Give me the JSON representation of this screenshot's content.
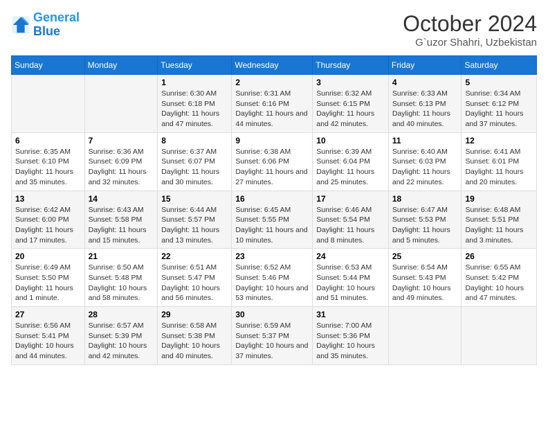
{
  "header": {
    "logo_line1": "General",
    "logo_line2": "Blue",
    "month": "October 2024",
    "location": "G`uzor Shahri, Uzbekistan"
  },
  "weekdays": [
    "Sunday",
    "Monday",
    "Tuesday",
    "Wednesday",
    "Thursday",
    "Friday",
    "Saturday"
  ],
  "weeks": [
    [
      {
        "day": "",
        "content": ""
      },
      {
        "day": "",
        "content": ""
      },
      {
        "day": "1",
        "content": "Sunrise: 6:30 AM\nSunset: 6:18 PM\nDaylight: 11 hours and 47 minutes."
      },
      {
        "day": "2",
        "content": "Sunrise: 6:31 AM\nSunset: 6:16 PM\nDaylight: 11 hours and 44 minutes."
      },
      {
        "day": "3",
        "content": "Sunrise: 6:32 AM\nSunset: 6:15 PM\nDaylight: 11 hours and 42 minutes."
      },
      {
        "day": "4",
        "content": "Sunrise: 6:33 AM\nSunset: 6:13 PM\nDaylight: 11 hours and 40 minutes."
      },
      {
        "day": "5",
        "content": "Sunrise: 6:34 AM\nSunset: 6:12 PM\nDaylight: 11 hours and 37 minutes."
      }
    ],
    [
      {
        "day": "6",
        "content": "Sunrise: 6:35 AM\nSunset: 6:10 PM\nDaylight: 11 hours and 35 minutes."
      },
      {
        "day": "7",
        "content": "Sunrise: 6:36 AM\nSunset: 6:09 PM\nDaylight: 11 hours and 32 minutes."
      },
      {
        "day": "8",
        "content": "Sunrise: 6:37 AM\nSunset: 6:07 PM\nDaylight: 11 hours and 30 minutes."
      },
      {
        "day": "9",
        "content": "Sunrise: 6:38 AM\nSunset: 6:06 PM\nDaylight: 11 hours and 27 minutes."
      },
      {
        "day": "10",
        "content": "Sunrise: 6:39 AM\nSunset: 6:04 PM\nDaylight: 11 hours and 25 minutes."
      },
      {
        "day": "11",
        "content": "Sunrise: 6:40 AM\nSunset: 6:03 PM\nDaylight: 11 hours and 22 minutes."
      },
      {
        "day": "12",
        "content": "Sunrise: 6:41 AM\nSunset: 6:01 PM\nDaylight: 11 hours and 20 minutes."
      }
    ],
    [
      {
        "day": "13",
        "content": "Sunrise: 6:42 AM\nSunset: 6:00 PM\nDaylight: 11 hours and 17 minutes."
      },
      {
        "day": "14",
        "content": "Sunrise: 6:43 AM\nSunset: 5:58 PM\nDaylight: 11 hours and 15 minutes."
      },
      {
        "day": "15",
        "content": "Sunrise: 6:44 AM\nSunset: 5:57 PM\nDaylight: 11 hours and 13 minutes."
      },
      {
        "day": "16",
        "content": "Sunrise: 6:45 AM\nSunset: 5:55 PM\nDaylight: 11 hours and 10 minutes."
      },
      {
        "day": "17",
        "content": "Sunrise: 6:46 AM\nSunset: 5:54 PM\nDaylight: 11 hours and 8 minutes."
      },
      {
        "day": "18",
        "content": "Sunrise: 6:47 AM\nSunset: 5:53 PM\nDaylight: 11 hours and 5 minutes."
      },
      {
        "day": "19",
        "content": "Sunrise: 6:48 AM\nSunset: 5:51 PM\nDaylight: 11 hours and 3 minutes."
      }
    ],
    [
      {
        "day": "20",
        "content": "Sunrise: 6:49 AM\nSunset: 5:50 PM\nDaylight: 11 hours and 1 minute."
      },
      {
        "day": "21",
        "content": "Sunrise: 6:50 AM\nSunset: 5:48 PM\nDaylight: 10 hours and 58 minutes."
      },
      {
        "day": "22",
        "content": "Sunrise: 6:51 AM\nSunset: 5:47 PM\nDaylight: 10 hours and 56 minutes."
      },
      {
        "day": "23",
        "content": "Sunrise: 6:52 AM\nSunset: 5:46 PM\nDaylight: 10 hours and 53 minutes."
      },
      {
        "day": "24",
        "content": "Sunrise: 6:53 AM\nSunset: 5:44 PM\nDaylight: 10 hours and 51 minutes."
      },
      {
        "day": "25",
        "content": "Sunrise: 6:54 AM\nSunset: 5:43 PM\nDaylight: 10 hours and 49 minutes."
      },
      {
        "day": "26",
        "content": "Sunrise: 6:55 AM\nSunset: 5:42 PM\nDaylight: 10 hours and 47 minutes."
      }
    ],
    [
      {
        "day": "27",
        "content": "Sunrise: 6:56 AM\nSunset: 5:41 PM\nDaylight: 10 hours and 44 minutes."
      },
      {
        "day": "28",
        "content": "Sunrise: 6:57 AM\nSunset: 5:39 PM\nDaylight: 10 hours and 42 minutes."
      },
      {
        "day": "29",
        "content": "Sunrise: 6:58 AM\nSunset: 5:38 PM\nDaylight: 10 hours and 40 minutes."
      },
      {
        "day": "30",
        "content": "Sunrise: 6:59 AM\nSunset: 5:37 PM\nDaylight: 10 hours and 37 minutes."
      },
      {
        "day": "31",
        "content": "Sunrise: 7:00 AM\nSunset: 5:36 PM\nDaylight: 10 hours and 35 minutes."
      },
      {
        "day": "",
        "content": ""
      },
      {
        "day": "",
        "content": ""
      }
    ]
  ]
}
